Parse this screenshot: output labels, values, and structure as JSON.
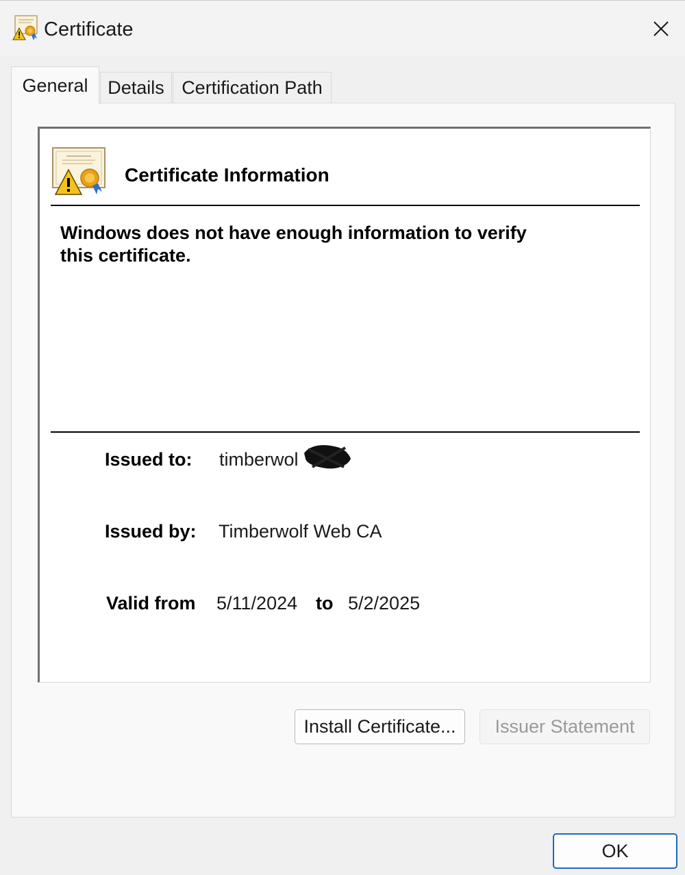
{
  "window": {
    "title": "Certificate",
    "close_icon": "close-icon"
  },
  "tabs": [
    {
      "label": "General",
      "active": true
    },
    {
      "label": "Details",
      "active": false
    },
    {
      "label": "Certification Path",
      "active": false
    }
  ],
  "general": {
    "heading": "Certificate Information",
    "icon": "certificate-warning-icon",
    "warning_line1": "Windows does not have enough information to verify",
    "warning_line2": "this certificate.",
    "issued_to_label": "Issued to:",
    "issued_to_value": "timberwol",
    "issued_by_label": "Issued by:",
    "issued_by_value": "Timberwolf Web CA",
    "valid_from_label": "Valid from",
    "valid_from_value": "5/11/2024",
    "valid_to_label": "to",
    "valid_to_value": "5/2/2025"
  },
  "buttons": {
    "install": "Install Certificate...",
    "issuer_statement": "Issuer Statement",
    "issuer_statement_enabled": false,
    "ok": "OK"
  },
  "colors": {
    "accent": "#1a68c7",
    "warning": "#f4c21f",
    "disabled_text": "#9a9a9a"
  }
}
